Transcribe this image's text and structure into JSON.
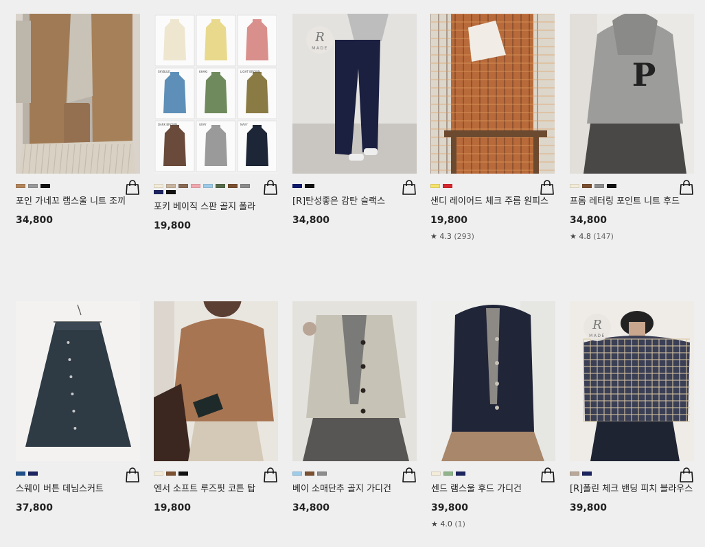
{
  "products": [
    {
      "name": "포인 가네꼬 램스울 니트 조끼",
      "price": "34,800",
      "rating": "",
      "count": "",
      "image_kind": "knit-vest",
      "colors": [
        "#b3855a",
        "#9a9a9a",
        "#111111"
      ]
    },
    {
      "name": "포키 베이직 스판 골지 폴라",
      "price": "19,800",
      "rating": "",
      "count": "",
      "image_kind": "turtleneck-grid",
      "colors": [
        "#f3ecd8",
        "#c9b59f",
        "#8a6b55",
        "#f1a9b0",
        "#9ecbe8",
        "#556b4a",
        "#7a5030",
        "#8c8c8c",
        "#1b2360",
        "#111111"
      ],
      "grid_labels": [
        "SKYBLUE",
        "KHAKI",
        "LIGHT BROWN",
        "DARK BROWN",
        "GRAY",
        "NAVY"
      ]
    },
    {
      "name": "[R]탄성좋은 감탄 슬랙스",
      "price": "34,800",
      "rating": "",
      "count": "",
      "image_kind": "navy-slacks",
      "colors": [
        "#0e1a6e",
        "#111111"
      ],
      "badge_letter": "R",
      "badge_text": "MADE"
    },
    {
      "name": "샌디 레이어드 체크 주름 원피스",
      "price": "19,800",
      "rating": "★ 4.3",
      "count": "(293)",
      "image_kind": "check-dress",
      "colors": [
        "#f5e36b",
        "#d7282f"
      ]
    },
    {
      "name": "프롬 레터링 포인트 니트 후드",
      "price": "34,800",
      "rating": "★ 4.8",
      "count": "(147)",
      "image_kind": "letter-hoodie",
      "colors": [
        "#f3ecd8",
        "#7a5030",
        "#8c8c8c",
        "#111111"
      ],
      "hoodie_letter": "P"
    },
    {
      "name": "스웨이 버튼 데님스커트",
      "price": "37,800",
      "rating": "",
      "count": "",
      "image_kind": "denim-skirt",
      "colors": [
        "#1f4f8a",
        "#1b2360"
      ]
    },
    {
      "name": "엔서 소프트 루즈핏 코튼 탑",
      "price": "19,800",
      "rating": "",
      "count": "",
      "image_kind": "cotton-top",
      "colors": [
        "#f3ecd8",
        "#7a5030",
        "#111111"
      ]
    },
    {
      "name": "베이 소매단추 골지 가디건",
      "price": "34,800",
      "rating": "",
      "count": "",
      "image_kind": "beige-cardigan",
      "colors": [
        "#9ecbe8",
        "#7a5030",
        "#8c8c8c"
      ]
    },
    {
      "name": "센드 램스울 후드 가디건",
      "price": "39,800",
      "rating": "★ 4.0",
      "count": "(1)",
      "image_kind": "navy-hood-cardigan",
      "colors": [
        "#f3ecd8",
        "#8fb48a",
        "#1b2360"
      ]
    },
    {
      "name": "[R]폴린 체크 밴딩 피치 블라우스",
      "price": "39,800",
      "rating": "",
      "count": "",
      "image_kind": "check-blouse",
      "colors": [
        "#b9a89a",
        "#1b2360"
      ],
      "badge_letter": "R",
      "badge_text": "MADE"
    }
  ]
}
